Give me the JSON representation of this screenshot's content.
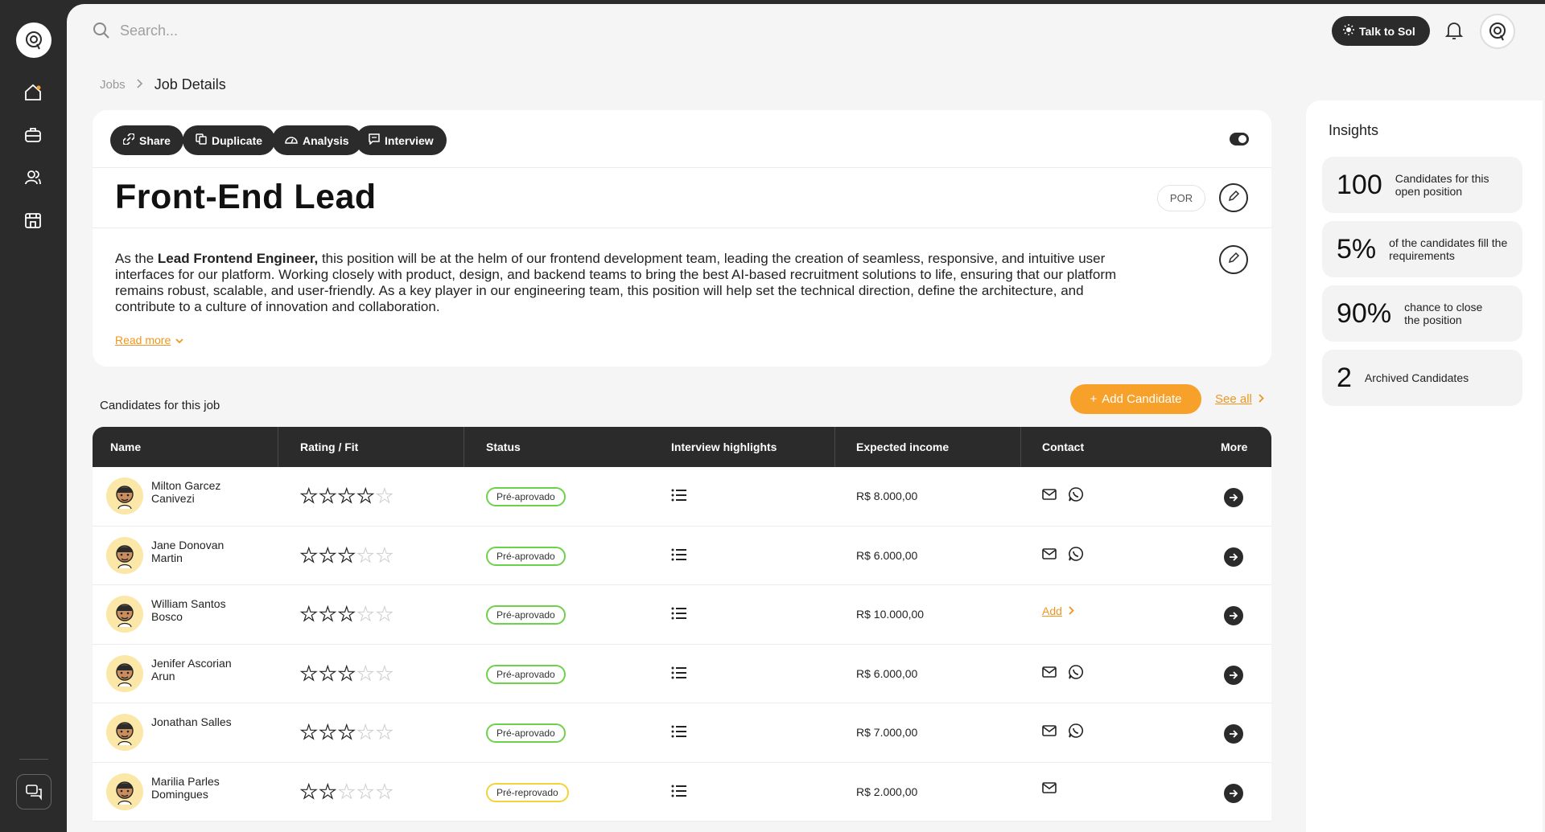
{
  "search": {
    "placeholder": "Search..."
  },
  "header": {
    "talk_label": "Talk to Sol"
  },
  "breadcrumb": {
    "parent": "Jobs",
    "current": "Job Details"
  },
  "job": {
    "actions": [
      "Share",
      "Duplicate",
      "Analysis",
      "Interview"
    ],
    "title": "Front-End Lead",
    "language": "POR",
    "description_prefix": "As the ",
    "description_bold": "Lead Frontend Engineer,",
    "description_rest": " this position will be at the helm of our frontend development team, leading the creation of seamless, responsive, and intuitive user interfaces for our platform. Working closely with product, design, and backend teams to bring the best AI-based recruitment solutions to life, ensuring that our platform remains robust, scalable, and user-friendly. As a key player in our engineering team, this position will help set the technical direction, define the architecture, and contribute to a culture of innovation and collaboration.",
    "read_more": "Read more"
  },
  "candidates": {
    "section_title": "Candidates for this job",
    "add_label": "Add Candidate",
    "see_all": "See all",
    "columns": [
      "Name",
      "Rating / Fit",
      "Status",
      "Interview highlights",
      "Expected income",
      "Contact",
      "More"
    ],
    "rows": [
      {
        "name": "Milton Garcez Canivezi",
        "rating": 4,
        "status": "Pré-aprovado",
        "status_type": "ok",
        "income": "R$ 8.000,00",
        "contact": "both"
      },
      {
        "name": "Jane Donovan Martin",
        "rating": 3,
        "status": "Pré-aprovado",
        "status_type": "ok",
        "income": "R$ 6.000,00",
        "contact": "both"
      },
      {
        "name": "William Santos Bosco",
        "rating": 3,
        "status": "Pré-aprovado",
        "status_type": "ok",
        "income": "R$ 10.000,00",
        "contact": "add",
        "contact_add_label": "Add"
      },
      {
        "name": "Jenifer Ascorian Arun",
        "rating": 3,
        "status": "Pré-aprovado",
        "status_type": "ok",
        "income": "R$ 6.000,00",
        "contact": "both"
      },
      {
        "name": "Jonathan Salles",
        "rating": 3,
        "status": "Pré-aprovado",
        "status_type": "ok",
        "income": "R$ 7.000,00",
        "contact": "both"
      },
      {
        "name": "Marilia Parles Domingues",
        "rating": 2,
        "status": "Pré-reprovado",
        "status_type": "warn",
        "income": "R$ 2.000,00",
        "contact": "email"
      }
    ]
  },
  "insights": {
    "title": "Insights",
    "cards": [
      {
        "value": "100",
        "label": "Candidates for this open position"
      },
      {
        "value": "5%",
        "label": "of the candidates fill the requirements"
      },
      {
        "value": "90%",
        "label": "chance to close the position"
      },
      {
        "value": "2",
        "label": "Archived Candidates"
      }
    ]
  },
  "colors": {
    "accent": "#f7a12a",
    "dark": "#2b2b2b",
    "status_ok": "#6ed14a",
    "status_warn": "#f0d43a"
  }
}
